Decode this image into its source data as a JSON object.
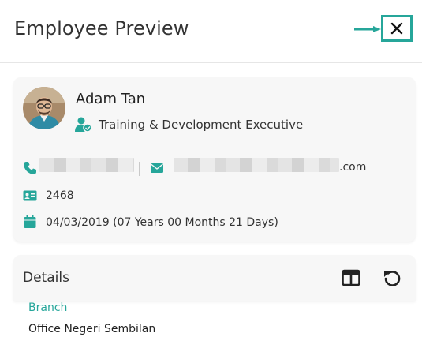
{
  "header": {
    "title": "Employee Preview",
    "close_icon": "close-icon",
    "arrow_icon": "arrow-right-icon"
  },
  "employee": {
    "name": "Adam Tan",
    "position": "Training & Development Executive",
    "phone_icon": "phone-icon",
    "email_icon": "email-icon",
    "email_suffix": ".com",
    "id_icon": "id-card-icon",
    "employee_id": "2468",
    "calendar_icon": "calendar-icon",
    "join_date": "04/03/2019 (07 Years 00 Months 21 Days)"
  },
  "details": {
    "title": "Details",
    "columns_icon": "columns-icon",
    "refresh_icon": "refresh-icon",
    "fields": [
      {
        "label": "Branch",
        "value": "Office Negeri Sembilan"
      }
    ]
  },
  "colors": {
    "accent": "#26a69a",
    "card_bg": "#f7f7f7"
  }
}
